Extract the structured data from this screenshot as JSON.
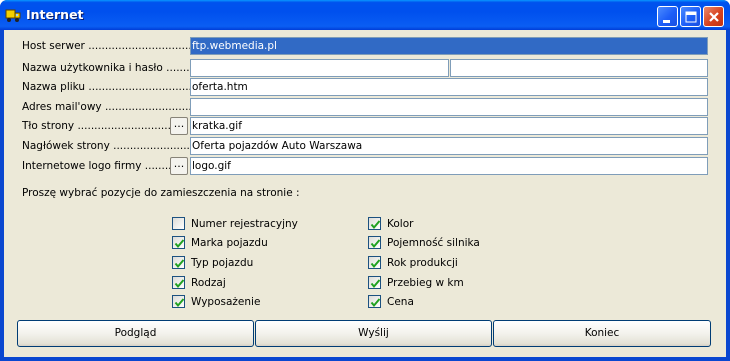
{
  "window": {
    "title": "Internet",
    "colors": {
      "titlebar": "#0054e3",
      "face": "#ece9d8",
      "selection": "#316ac5"
    }
  },
  "form": {
    "host": {
      "label": "Host serwer ........................................",
      "value": "ftp.webmedia.pl"
    },
    "login": {
      "label": "Nazwa użytkownika i hasło ................",
      "user": "",
      "password": ""
    },
    "filename": {
      "label": "Nazwa pliku ........................................",
      "value": "oferta.htm"
    },
    "email": {
      "label": "Adres mail'owy ...............................",
      "value": ""
    },
    "background": {
      "label": "Tło strony ...........................................",
      "button": "...",
      "value": "kratka.gif"
    },
    "header": {
      "label": "Nagłówek strony ...............................",
      "value": "Oferta pojazdów Auto Warszawa"
    },
    "logo": {
      "label": "Internetowe logo firmy ...............",
      "button": "...",
      "value": "logo.gif"
    }
  },
  "section_prompt": "Proszę wybrać pozycje do zamieszczenia na stronie :",
  "options": {
    "col1": [
      {
        "label": "Numer rejestracyjny",
        "checked": false
      },
      {
        "label": "Marka pojazdu",
        "checked": true
      },
      {
        "label": "Typ pojazdu",
        "checked": true
      },
      {
        "label": "Rodzaj",
        "checked": true
      },
      {
        "label": "Wyposażenie",
        "checked": true
      }
    ],
    "col2": [
      {
        "label": "Kolor",
        "checked": true
      },
      {
        "label": "Pojemność silnika",
        "checked": true
      },
      {
        "label": "Rok produkcji",
        "checked": true
      },
      {
        "label": "Przebieg w km",
        "checked": true
      },
      {
        "label": "Cena",
        "checked": true
      }
    ]
  },
  "buttons": {
    "preview": "Podgląd",
    "send": "Wyślij",
    "close": "Koniec"
  }
}
